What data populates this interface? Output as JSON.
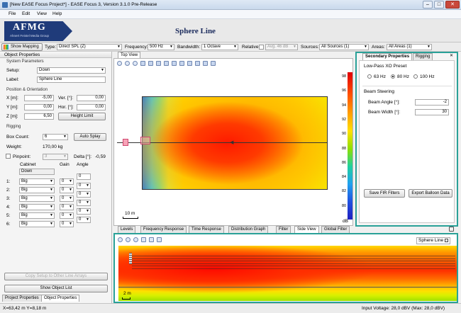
{
  "window": {
    "title": "[New EASE Focus Project*] - EASE Focus 3, Version 3.1.0 Pre-Release"
  },
  "menu": [
    "File",
    "Edit",
    "View",
    "Help"
  ],
  "banner": {
    "logo": "AFMG",
    "logo_sub": "Ahnert Feistel Media Group",
    "heading": "Sphere Line"
  },
  "toolbar": {
    "show_mapping": "Show Mapping",
    "type_label": "Type:",
    "type_value": "Direct SPL (Z)",
    "freq_label": "Frequency:",
    "freq_value": "500 Hz",
    "bw_label": "Bandwidth:",
    "bw_value": "1 Octave",
    "rel_label": "Relative:",
    "avg_value": "Avg. 46 dB",
    "sources_label": "Sources:",
    "sources_value": "All Sources (1)",
    "areas_label": "Areas:",
    "areas_value": "All Areas (1)"
  },
  "object_properties": {
    "title": "Object Properties",
    "system_params": "System Parameters",
    "setup_label": "Setup:",
    "setup_value": "Down",
    "label_label": "Label:",
    "label_value": "Sphere Line",
    "pos_orient": "Position & Orientation",
    "x_label": "X [m]:",
    "x_value": "-5,00",
    "y_label": "Y [m]:",
    "y_value": "0,00",
    "z_label": "Z [m]:",
    "z_value": "6,50",
    "ver_label": "Ver. [°]:",
    "ver_value": "0,00",
    "hor_label": "Hor. [°]:",
    "hor_value": "0,00",
    "height_limit": "Height Limit",
    "rigging": "Rigging",
    "box_count_label": "Box Count:",
    "box_count_value": "6",
    "auto_splay": "Auto Splay",
    "weight_label": "Weight:",
    "weight_value": "170,00 kg",
    "pinpoint_label": "Pinpoint:",
    "pinpoint_value": "3",
    "delta_label": "Delta [°]:",
    "delta_value": "-0,59",
    "col_cabinet": "Cabinet",
    "col_gain": "Gain",
    "col_angle": "Angle",
    "cabinet_header_value": "Down",
    "first_angle": "0",
    "rows": [
      {
        "num": "1:",
        "cab": "Big",
        "gain": "0",
        "angle": "0"
      },
      {
        "num": "2:",
        "cab": "Big",
        "gain": "0",
        "angle": "0"
      },
      {
        "num": "3:",
        "cab": "Big",
        "gain": "0",
        "angle": "0"
      },
      {
        "num": "4:",
        "cab": "Big",
        "gain": "0",
        "angle": "0"
      },
      {
        "num": "5:",
        "cab": "Big",
        "gain": "0",
        "angle": "0"
      },
      {
        "num": "6:",
        "cab": "Big",
        "gain": "0",
        "angle": ""
      }
    ],
    "copy_setup": "Copy Setup to Other Line Arrays",
    "show_object_list": "Show Object List",
    "tab_project": "Project Properties",
    "tab_object": "Object Properties"
  },
  "top_view": {
    "tab": "Top View",
    "scale_label": "10 m",
    "colorbar_ticks": [
      "98",
      "96",
      "94",
      "92",
      "90",
      "88",
      "86",
      "84",
      "82",
      "80"
    ],
    "colorbar_unit": "dB"
  },
  "secondary": {
    "tab_secondary": "Secondary Properties",
    "tab_rigging": "Rigging",
    "lowpass_title": "Low-Pass XO Preset",
    "opt_63": "63 Hz",
    "opt_80": "80 Hz",
    "opt_100": "100 Hz",
    "selected": "80 Hz",
    "beam_title": "Beam Steering",
    "beam_angle_label": "Beam Angle [°]:",
    "beam_angle_value": "-2",
    "beam_width_label": "Beam Width [°]:",
    "beam_width_value": "30",
    "save_fir": "Save FIR Filters",
    "export_balloon": "Export Balloon Data"
  },
  "bottom_tabs": [
    "Levels",
    "Frequency Response",
    "Time Response",
    "Distribution Graph",
    "Filter",
    "Side View",
    "Global Filter"
  ],
  "side_view": {
    "badge": "Sphere Line",
    "scale_label": "2 m"
  },
  "status": {
    "coords": "X=63,42 m Y=8,18 m",
    "voltage": "Input Voltage: 28,0 dBV (Max: 28,0 dBV)"
  },
  "colors": {
    "accent_teal": "#2aa198",
    "logo_navy": "#1f3b7a"
  }
}
